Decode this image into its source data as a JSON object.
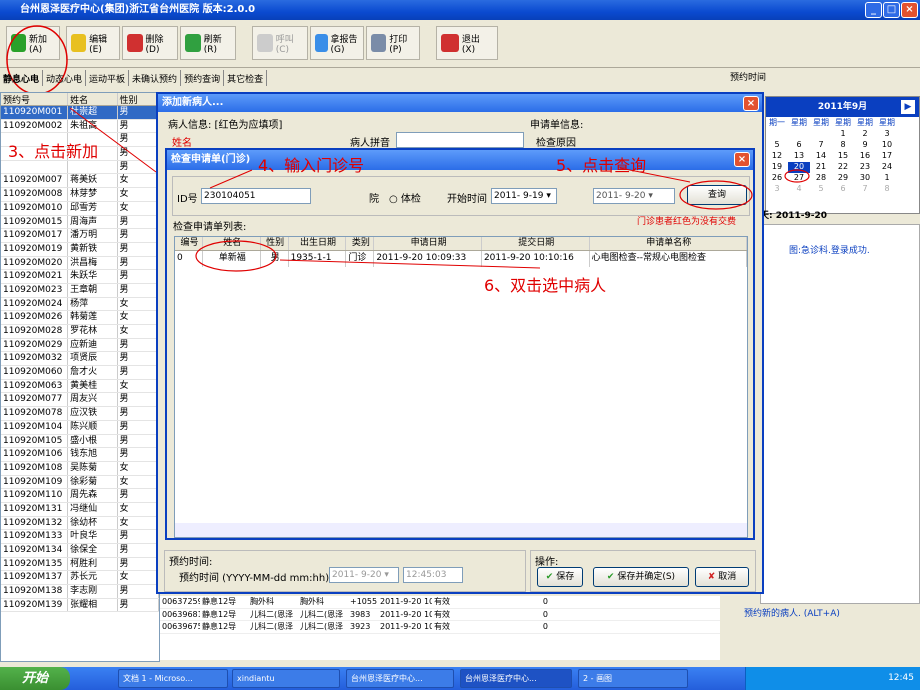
{
  "app": {
    "title": "台州恩泽医疗中心(集团)浙江省台州医院    版本:2.0.0"
  },
  "toolbar": [
    {
      "label": "新加(A)"
    },
    {
      "label": "编辑(E)"
    },
    {
      "label": "删除(D)"
    },
    {
      "label": "刷新(R)"
    },
    {
      "label": "呼叫(C)"
    },
    {
      "label": "拿报告(G)"
    },
    {
      "label": "打印(P)"
    },
    {
      "label": "退出(X)"
    }
  ],
  "tabs": [
    "静息心电",
    "动态心电",
    "运动平板",
    "未确认预约",
    "预约查询",
    "其它检查"
  ],
  "patient_grid": {
    "headers": [
      "预约号",
      "姓名",
      "性别"
    ],
    "rows": [
      [
        "110920M001",
        "杜崇超",
        "男"
      ],
      [
        "110920M002",
        "朱祖高",
        "男"
      ],
      [
        "",
        "",
        "男"
      ],
      [
        "",
        "",
        "男"
      ],
      [
        "",
        "",
        "男"
      ],
      [
        "110920M007",
        "蒋美妖",
        "女"
      ],
      [
        "110920M008",
        "林芽梦",
        "女"
      ],
      [
        "110920M010",
        "邱雪芳",
        "女"
      ],
      [
        "110920M015",
        "周海声",
        "男"
      ],
      [
        "110920M017",
        "潘万明",
        "男"
      ],
      [
        "110920M019",
        "黄新铁",
        "男"
      ],
      [
        "110920M020",
        "洪昌梅",
        "男"
      ],
      [
        "110920M021",
        "朱跃华",
        "男"
      ],
      [
        "110920M023",
        "王章朝",
        "男"
      ],
      [
        "110920M024",
        "杨萍",
        "女"
      ],
      [
        "110920M026",
        "韩菊莲",
        "女"
      ],
      [
        "110920M028",
        "罗花林",
        "女"
      ],
      [
        "110920M029",
        "应新迪",
        "男"
      ],
      [
        "110920M032",
        "项贤辰",
        "男"
      ],
      [
        "110920M060",
        "詹才火",
        "男"
      ],
      [
        "110920M063",
        "黄美桂",
        "女"
      ],
      [
        "110920M077",
        "周友兴",
        "男"
      ],
      [
        "110920M078",
        "应汉铁",
        "男"
      ],
      [
        "110920M104",
        "陈兴顺",
        "男"
      ],
      [
        "110920M105",
        "盛小根",
        "男"
      ],
      [
        "110920M106",
        "钱东旭",
        "男"
      ],
      [
        "110920M108",
        "吴陈菊",
        "女"
      ],
      [
        "110920M109",
        "徐彩菊",
        "女"
      ],
      [
        "110920M110",
        "周先森",
        "男"
      ],
      [
        "110920M131",
        "冯继仙",
        "女"
      ],
      [
        "110920M132",
        "徐幼杯",
        "女"
      ],
      [
        "110920M133",
        "叶良华",
        "男"
      ],
      [
        "110920M134",
        "徐保全",
        "男"
      ],
      [
        "110920M135",
        "柯胜利",
        "男"
      ],
      [
        "110920M137",
        "苏长元",
        "女"
      ],
      [
        "110920M138",
        "李志刚",
        "男"
      ],
      [
        "110920M139",
        "张耀相",
        "男"
      ]
    ]
  },
  "bottom_rows": [
    [
      "00637259",
      "静息12导",
      "胸外科",
      "胸外科",
      "+1055",
      "2011-9-20 10:0",
      "有效",
      "0"
    ],
    [
      "00639681",
      "静息12导",
      "儿科二(恩泽",
      "儿科二(恩泽",
      "3983",
      "2011-9-20 10:0",
      "有效",
      "0"
    ],
    [
      "00639675",
      "静息12导",
      "儿科二(恩泽",
      "儿科二(恩泽",
      "3923",
      "2011-9-20 10:0",
      "有效",
      "0"
    ]
  ],
  "add_dialog": {
    "title": "添加新病人...",
    "patient_info_label": "病人信息: [红色为应填项]",
    "name_label": "姓名",
    "pinyin_label": "病人拼音",
    "request_info_label": "申请单信息:",
    "reason_label": "检查原因",
    "appointment_label": "预约时间:",
    "appointment_time_label": "预约时间 (YYYY-MM-dd mm:hh)",
    "date_value": "2011- 9-20",
    "time_value": "12:45:03",
    "ops_label": "操作:",
    "save": "保存",
    "save_confirm": "保存并确定(S)",
    "cancel": "取消"
  },
  "search_dialog": {
    "title": "检查申请单(门诊)",
    "id_label": "ID号",
    "id_value": "230104051",
    "radio_label": "院",
    "radio2_label": "体检",
    "start_label": "开始时间",
    "start_value": "2011- 9-19",
    "end_value": "2011- 9-20",
    "query": "查询",
    "note": "门诊患者红色为没有交费",
    "list_label": "检查申请单列表:",
    "headers": [
      "编号",
      "姓名",
      "性别",
      "出生日期",
      "类别",
      "申请日期",
      "提交日期",
      "申请单名称"
    ],
    "rows": [
      [
        "0",
        "单新福",
        "男",
        "1935-1-1",
        "门诊",
        "2011-9-20 10:09:33",
        "2011-9-20 10:10:16",
        "心电图检查--常规心电图检查"
      ]
    ]
  },
  "annotations": {
    "a3": "3、点击新加",
    "a4": "4、输入门诊号",
    "a5": "5、点击查询",
    "a6": "6、双击选中病人"
  },
  "right_panel": {
    "appt_label": "预约时间",
    "month": "2011年9月",
    "weekdays": [
      "期一",
      "星期二",
      "星期三",
      "星期四",
      "星期五",
      "星期六"
    ],
    "weeks": [
      [
        "",
        "",
        "",
        "1",
        "2",
        "3"
      ],
      [
        "5",
        "6",
        "7",
        "8",
        "9",
        "10"
      ],
      [
        "12",
        "13",
        "14",
        "15",
        "16",
        "17"
      ],
      [
        "19",
        "20",
        "21",
        "22",
        "23",
        "24"
      ],
      [
        "26",
        "27",
        "28",
        "29",
        "30",
        "1"
      ],
      [
        "3",
        "4",
        "5",
        "6",
        "7",
        "8"
      ]
    ],
    "today_label": "天: 2011-9-20",
    "log_text": "图:急诊科.登录成功.",
    "hint_text": "预约新的病人. (ALT+A)"
  },
  "taskbar": {
    "start": "开始",
    "tasks": [
      "文档 1 - Microso...",
      "xindiantu",
      "台州恩泽医疗中心...",
      "台州恩泽医疗中心...",
      "2 - 画图"
    ],
    "clock": "12:45"
  },
  "colors": {
    "title_blue": "#0a4ad0",
    "annotation_red": "#e00000"
  }
}
